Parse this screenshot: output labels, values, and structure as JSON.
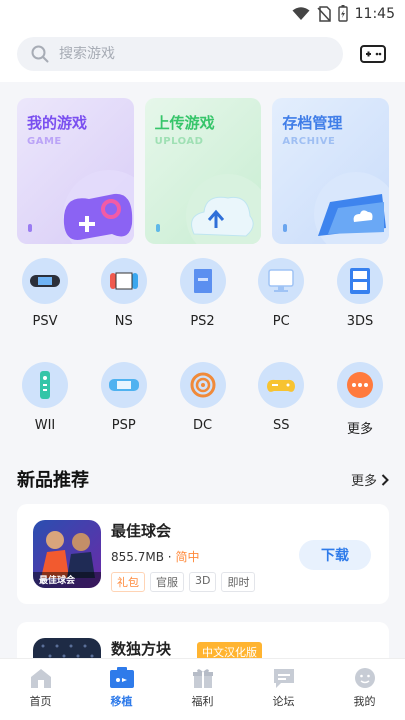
{
  "status": {
    "time": "11:45"
  },
  "search": {
    "placeholder": "搜索游戏"
  },
  "cards": [
    {
      "title": "我的游戏",
      "sub": "GAME"
    },
    {
      "title": "上传游戏",
      "sub": "UPLOAD"
    },
    {
      "title": "存档管理",
      "sub": "ARCHIVE"
    }
  ],
  "platforms": [
    {
      "label": "PSV",
      "icon": "psv-icon"
    },
    {
      "label": "NS",
      "icon": "switch-icon"
    },
    {
      "label": "PS2",
      "icon": "ps2-icon"
    },
    {
      "label": "PC",
      "icon": "monitor-icon"
    },
    {
      "label": "3DS",
      "icon": "3ds-icon"
    },
    {
      "label": "WII",
      "icon": "wii-remote-icon"
    },
    {
      "label": "PSP",
      "icon": "psp-icon"
    },
    {
      "label": "DC",
      "icon": "dreamcast-icon"
    },
    {
      "label": "SS",
      "icon": "saturn-icon"
    },
    {
      "label": "更多",
      "icon": "more-icon"
    }
  ],
  "section": {
    "title": "新品推荐",
    "more": "更多"
  },
  "games": [
    {
      "name": "最佳球会",
      "size": "855.7MB",
      "sep": "·",
      "lang": "简中",
      "tags": [
        "礼包",
        "官服",
        "3D",
        "即时"
      ],
      "button": "下载",
      "icon_text": "最佳球会"
    },
    {
      "name": "数独方块",
      "badge": "中文汉化版"
    }
  ],
  "tabs": [
    {
      "label": "首页"
    },
    {
      "label": "移植"
    },
    {
      "label": "福利"
    },
    {
      "label": "论坛"
    },
    {
      "label": "我的"
    }
  ],
  "colors": {
    "accent": "#2f7bea",
    "orange": "#ff8a3c"
  }
}
